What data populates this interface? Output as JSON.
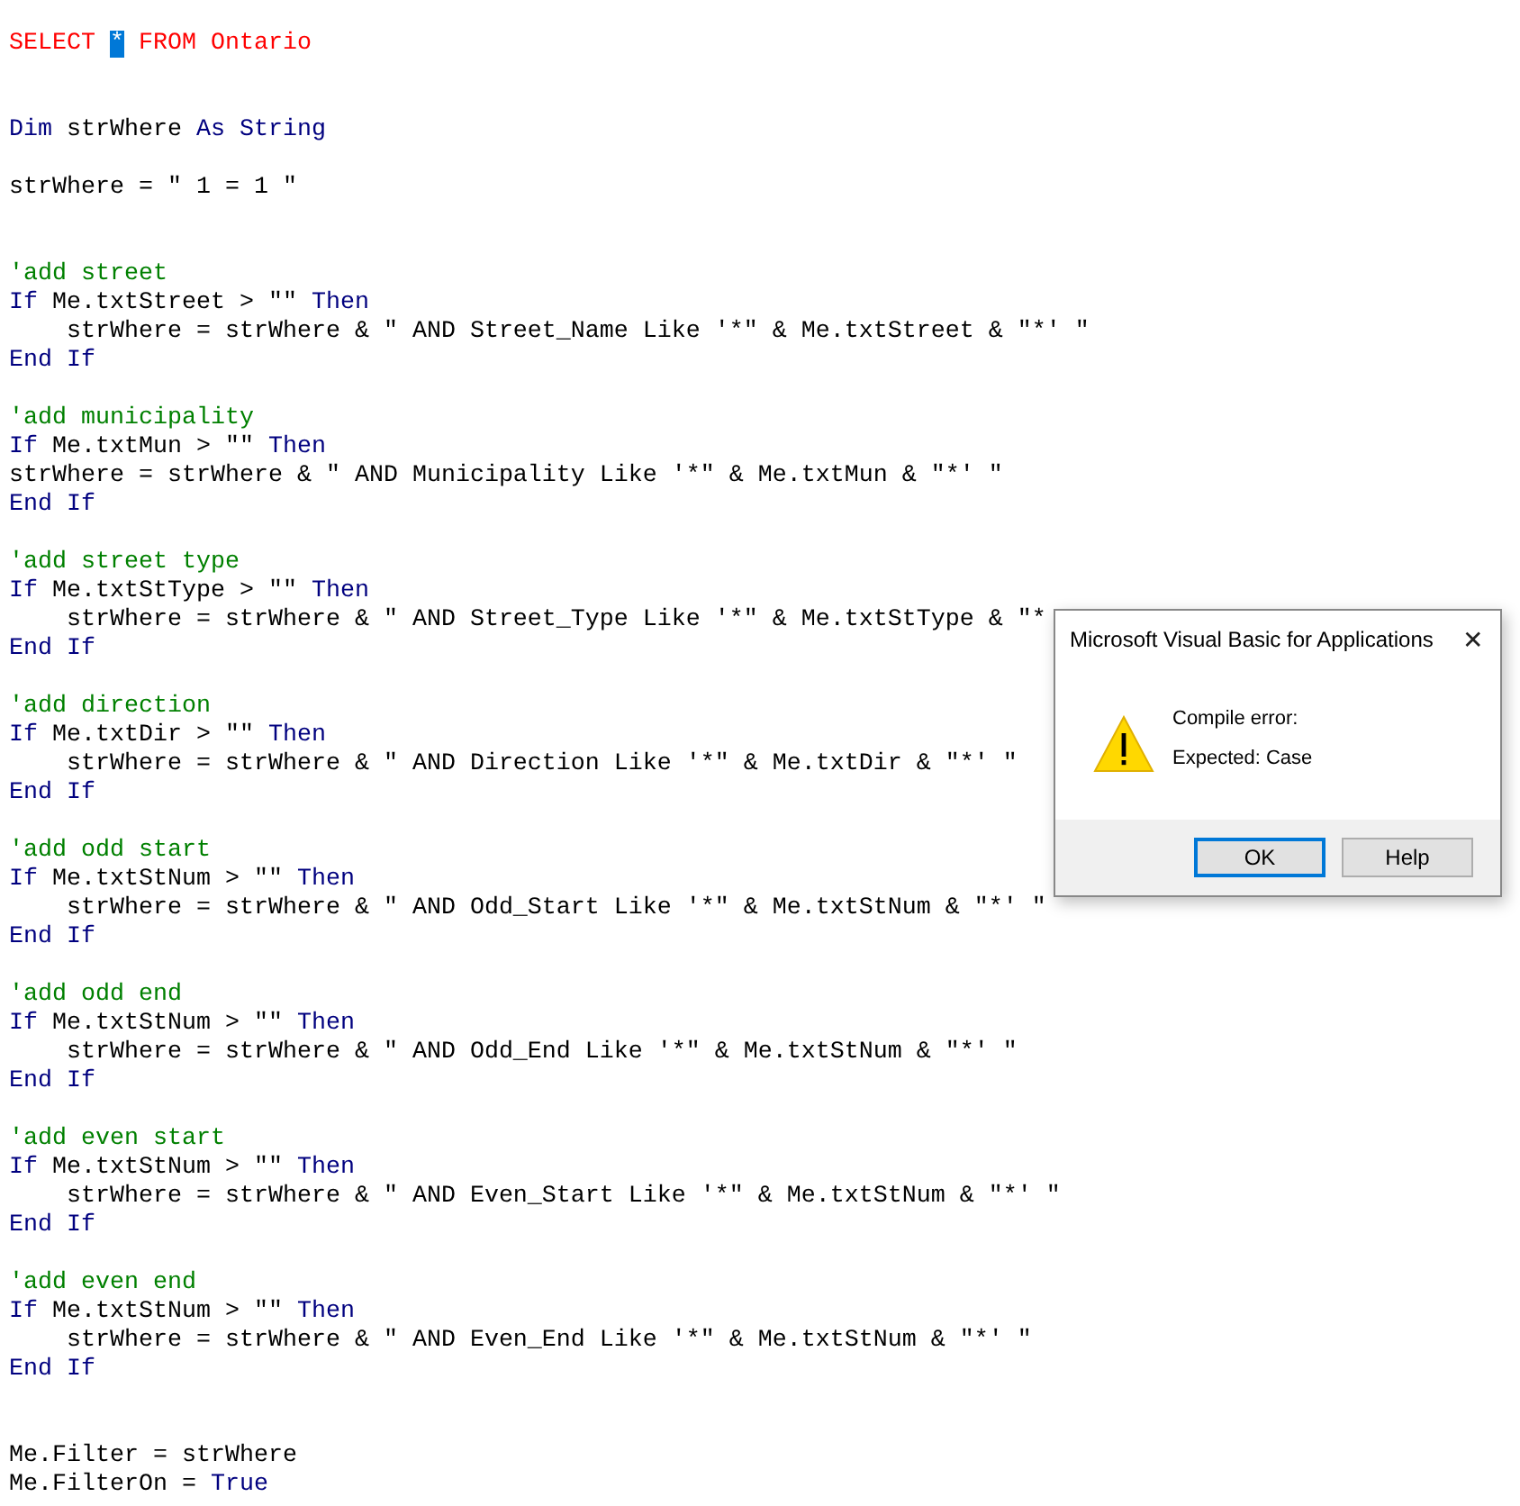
{
  "editor": {
    "lines": [
      {
        "kind": "code",
        "segments": [
          {
            "text": "SELECT ",
            "kind": "error"
          },
          {
            "text": "*",
            "kind": "selected"
          },
          {
            "text": " FROM Ontario",
            "kind": "error"
          }
        ]
      },
      {
        "kind": "blank"
      },
      {
        "kind": "blank"
      },
      {
        "kind": "code",
        "segments": [
          {
            "text": "Dim",
            "kind": "keyword"
          },
          {
            "text": " strWhere ",
            "kind": "plain"
          },
          {
            "text": "As String",
            "kind": "keyword"
          }
        ]
      },
      {
        "kind": "blank"
      },
      {
        "kind": "code",
        "segments": [
          {
            "text": "strWhere = \" 1 = 1 \"",
            "kind": "plain"
          }
        ]
      },
      {
        "kind": "blank"
      },
      {
        "kind": "blank"
      },
      {
        "kind": "code",
        "segments": [
          {
            "text": "'add street",
            "kind": "comment"
          }
        ]
      },
      {
        "kind": "code",
        "segments": [
          {
            "text": "If",
            "kind": "keyword"
          },
          {
            "text": " Me.txtStreet > \"\" ",
            "kind": "plain"
          },
          {
            "text": "Then",
            "kind": "keyword"
          }
        ]
      },
      {
        "kind": "code",
        "segments": [
          {
            "text": "    strWhere = strWhere & \" AND Street_Name Like '*\" & Me.txtStreet & \"*' \"",
            "kind": "plain"
          }
        ]
      },
      {
        "kind": "code",
        "segments": [
          {
            "text": "End If",
            "kind": "keyword"
          }
        ]
      },
      {
        "kind": "blank"
      },
      {
        "kind": "code",
        "segments": [
          {
            "text": "'add municipality",
            "kind": "comment"
          }
        ]
      },
      {
        "kind": "code",
        "segments": [
          {
            "text": "If",
            "kind": "keyword"
          },
          {
            "text": " Me.txtMun > \"\" ",
            "kind": "plain"
          },
          {
            "text": "Then",
            "kind": "keyword"
          }
        ]
      },
      {
        "kind": "code",
        "segments": [
          {
            "text": "strWhere = strWhere & \" AND Municipality Like '*\" & Me.txtMun & \"*' \"",
            "kind": "plain"
          }
        ]
      },
      {
        "kind": "code",
        "segments": [
          {
            "text": "End If",
            "kind": "keyword"
          }
        ]
      },
      {
        "kind": "blank"
      },
      {
        "kind": "code",
        "segments": [
          {
            "text": "'add street type",
            "kind": "comment"
          }
        ]
      },
      {
        "kind": "code",
        "segments": [
          {
            "text": "If",
            "kind": "keyword"
          },
          {
            "text": " Me.txtStType > \"\" ",
            "kind": "plain"
          },
          {
            "text": "Then",
            "kind": "keyword"
          }
        ]
      },
      {
        "kind": "code",
        "segments": [
          {
            "text": "    strWhere = strWhere & \" AND Street_Type Like '*\" & Me.txtStType & \"*",
            "kind": "plain"
          }
        ]
      },
      {
        "kind": "code",
        "segments": [
          {
            "text": "End If",
            "kind": "keyword"
          }
        ]
      },
      {
        "kind": "blank"
      },
      {
        "kind": "code",
        "segments": [
          {
            "text": "'add direction",
            "kind": "comment"
          }
        ]
      },
      {
        "kind": "code",
        "segments": [
          {
            "text": "If",
            "kind": "keyword"
          },
          {
            "text": " Me.txtDir > \"\" ",
            "kind": "plain"
          },
          {
            "text": "Then",
            "kind": "keyword"
          }
        ]
      },
      {
        "kind": "code",
        "segments": [
          {
            "text": "    strWhere = strWhere & \" AND Direction Like '*\" & Me.txtDir & \"*' \"",
            "kind": "plain"
          }
        ]
      },
      {
        "kind": "code",
        "segments": [
          {
            "text": "End If",
            "kind": "keyword"
          }
        ]
      },
      {
        "kind": "blank"
      },
      {
        "kind": "code",
        "segments": [
          {
            "text": "'add odd start",
            "kind": "comment"
          }
        ]
      },
      {
        "kind": "code",
        "segments": [
          {
            "text": "If",
            "kind": "keyword"
          },
          {
            "text": " Me.txtStNum > \"\" ",
            "kind": "plain"
          },
          {
            "text": "Then",
            "kind": "keyword"
          }
        ]
      },
      {
        "kind": "code",
        "segments": [
          {
            "text": "    strWhere = strWhere & \" AND Odd_Start Like '*\" & Me.txtStNum & \"*' \"",
            "kind": "plain"
          }
        ]
      },
      {
        "kind": "code",
        "segments": [
          {
            "text": "End If",
            "kind": "keyword"
          }
        ]
      },
      {
        "kind": "blank"
      },
      {
        "kind": "code",
        "segments": [
          {
            "text": "'add odd end",
            "kind": "comment"
          }
        ]
      },
      {
        "kind": "code",
        "segments": [
          {
            "text": "If",
            "kind": "keyword"
          },
          {
            "text": " Me.txtStNum > \"\" ",
            "kind": "plain"
          },
          {
            "text": "Then",
            "kind": "keyword"
          }
        ]
      },
      {
        "kind": "code",
        "segments": [
          {
            "text": "    strWhere = strWhere & \" AND Odd_End Like '*\" & Me.txtStNum & \"*' \"",
            "kind": "plain"
          }
        ]
      },
      {
        "kind": "code",
        "segments": [
          {
            "text": "End If",
            "kind": "keyword"
          }
        ]
      },
      {
        "kind": "blank"
      },
      {
        "kind": "code",
        "segments": [
          {
            "text": "'add even start",
            "kind": "comment"
          }
        ]
      },
      {
        "kind": "code",
        "segments": [
          {
            "text": "If",
            "kind": "keyword"
          },
          {
            "text": " Me.txtStNum > \"\" ",
            "kind": "plain"
          },
          {
            "text": "Then",
            "kind": "keyword"
          }
        ]
      },
      {
        "kind": "code",
        "segments": [
          {
            "text": "    strWhere = strWhere & \" AND Even_Start Like '*\" & Me.txtStNum & \"*' \"",
            "kind": "plain"
          }
        ]
      },
      {
        "kind": "code",
        "segments": [
          {
            "text": "End If",
            "kind": "keyword"
          }
        ]
      },
      {
        "kind": "blank"
      },
      {
        "kind": "code",
        "segments": [
          {
            "text": "'add even end",
            "kind": "comment"
          }
        ]
      },
      {
        "kind": "code",
        "segments": [
          {
            "text": "If",
            "kind": "keyword"
          },
          {
            "text": " Me.txtStNum > \"\" ",
            "kind": "plain"
          },
          {
            "text": "Then",
            "kind": "keyword"
          }
        ]
      },
      {
        "kind": "code",
        "segments": [
          {
            "text": "    strWhere = strWhere & \" AND Even_End Like '*\" & Me.txtStNum & \"*' \"",
            "kind": "plain"
          }
        ]
      },
      {
        "kind": "code",
        "segments": [
          {
            "text": "End If",
            "kind": "keyword"
          }
        ]
      },
      {
        "kind": "blank"
      },
      {
        "kind": "blank"
      },
      {
        "kind": "code",
        "segments": [
          {
            "text": "Me.Filter = strWhere",
            "kind": "plain"
          }
        ]
      },
      {
        "kind": "code",
        "segments": [
          {
            "text": "Me.FilterOn = ",
            "kind": "plain"
          },
          {
            "text": "True",
            "kind": "keyword"
          }
        ]
      }
    ]
  },
  "dialog": {
    "title": "Microsoft Visual Basic for Applications",
    "close": "✕",
    "heading": "Compile error:",
    "message": "Expected: Case",
    "buttons": [
      {
        "label": "OK",
        "default": true
      },
      {
        "label": "Help",
        "default": false
      }
    ]
  }
}
